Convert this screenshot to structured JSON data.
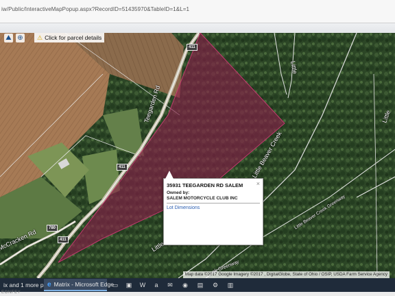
{
  "browser": {
    "url": "iw/Public/InteractiveMapPopup.aspx?RecordID=51435970&TableID=1&L=1"
  },
  "toolbar": {
    "hint_label": "Click for parcel details"
  },
  "map": {
    "road_labels": {
      "teegarden": "Teegarden Rd",
      "little_beaver_top": "Little",
      "little_beaver_right": "Little",
      "little_beaver_creek_1": "Little Beaver Creek",
      "little_beaver_creek_2": "Little Beaver Creek",
      "greenway": "Little Beaver Creek Greenway",
      "greenway_bottom": "ek Greenway",
      "mccracken": "McCracken Rd"
    },
    "route_shields": {
      "top": "411",
      "middle": "411",
      "bottom_a": "780",
      "bottom_b": "411"
    },
    "attribution": "Map data ©2017 Google Imagery ©2017 , DigitalGlobe, State of Ohio / OSIP, USDA Farm Service Agency"
  },
  "popup": {
    "address": "35931 TEEGARDEN RD SALEM",
    "owned_label": "Owned by:",
    "owner": "SALEM MOTORCYCLE CLUB INC",
    "link": "Lot Dimensions",
    "close_glyph": "×"
  },
  "taskbar": {
    "item1": "ix and 1 more pa...",
    "item2": "Matrix - Microsoft Edge"
  },
  "footer": {
    "text": "EONFEY"
  },
  "colors": {
    "parcel_fill": "#8a1f4a",
    "link_blue": "#2a5db0",
    "taskbar": "#1f2b3a"
  }
}
